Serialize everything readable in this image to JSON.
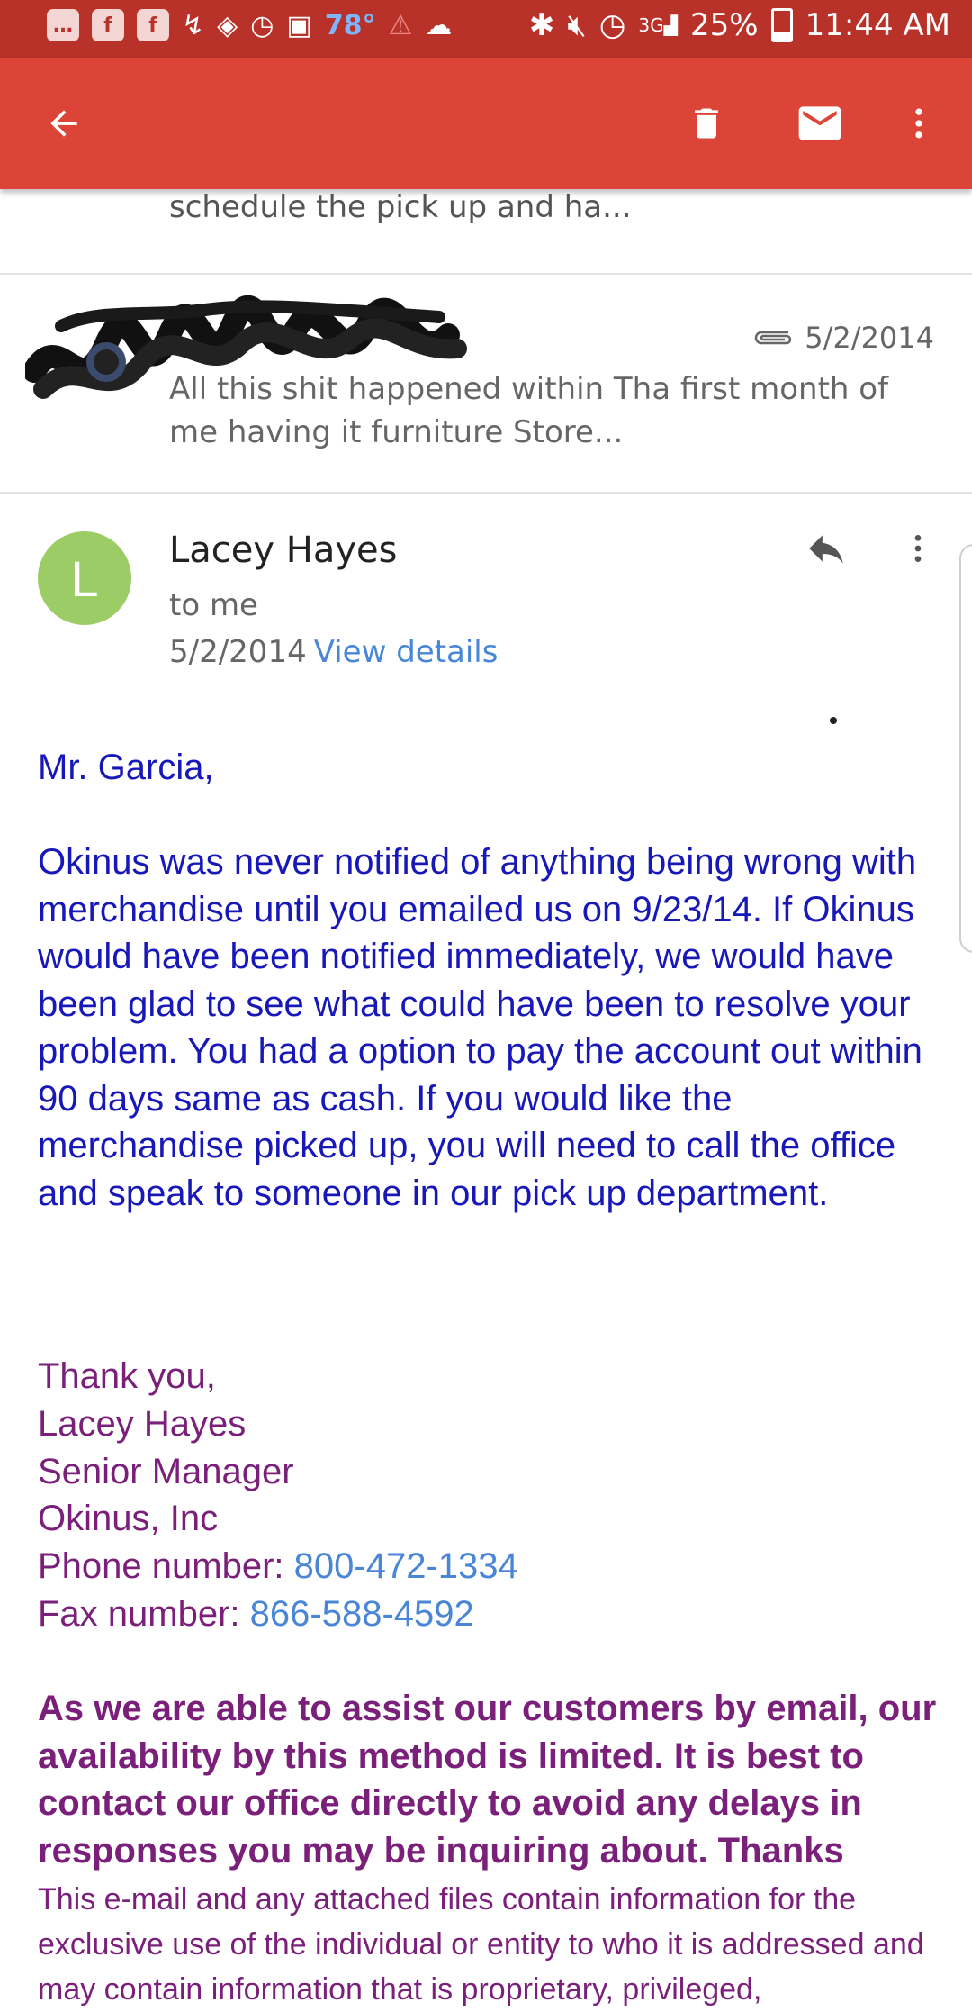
{
  "status_bar": {
    "temperature": "78°",
    "network": "3G",
    "battery": "25%",
    "time": "11:44 AM"
  },
  "toolbar": {
    "back_icon": "arrow-back",
    "delete_icon": "trash",
    "mark_unread_icon": "envelope",
    "more_icon": "more-vertical"
  },
  "previous_message": {
    "snippet": "schedule the pick up and ha..."
  },
  "collapsed_message": {
    "date": "5/2/2014",
    "has_attachment": true,
    "snippet": "All this shit happened within Tha first month of me having it furniture Store..."
  },
  "message": {
    "avatar_letter": "L",
    "avatar_color": "#9ccc65",
    "sender": "Lacey Hayes",
    "recipient": "to me",
    "date": "5/2/2014",
    "view_details": "View details",
    "greeting": "Mr. Garcia,",
    "paragraph": "Okinus was never notified of anything being wrong with merchandise until you emailed us on 9/23/14. If Okinus would have been notified immediately, we would have been glad to see what could have been to resolve your problem. You had a option to pay the account out within 90 days same as cash. If you would like the merchandise picked up, you will need to call the office and speak to someone in our pick up department.",
    "signature": {
      "closing": "Thank you,",
      "name": "Lacey Hayes",
      "title": "Senior Manager",
      "company": "Okinus, Inc",
      "phone_label": "Phone number: ",
      "phone": "800-472-1334",
      "fax_label": "Fax number: ",
      "fax": "866-588-4592"
    },
    "notice": "As we are able to assist our customers by email, our availability by this method is limited. It is best to contact our office directly to avoid any delays in responses you may be inquiring about. Thanks",
    "disclaimer": "This e-mail and any attached files contain information for the exclusive use of the individual or entity to who it is addressed and may contain information that is proprietary, privileged,"
  },
  "colors": {
    "app_bar": "#db4437",
    "status_bar": "#b8322a",
    "body_blue": "#1818b8",
    "body_purple": "#7a1f7a",
    "link": "#4a86d6"
  }
}
